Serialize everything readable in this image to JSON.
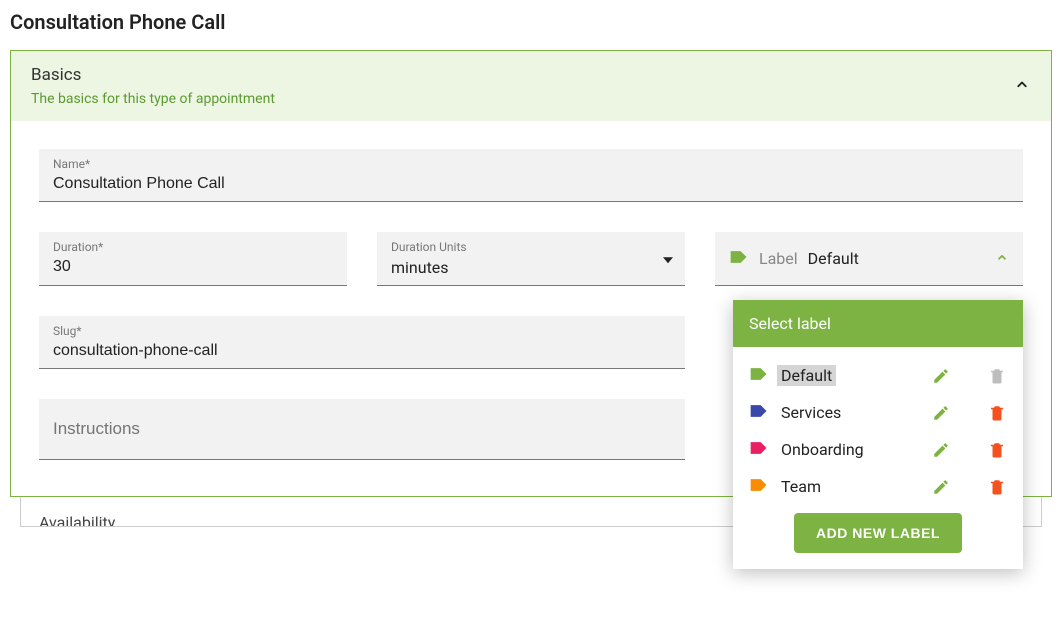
{
  "pageTitle": "Consultation Phone Call",
  "panel": {
    "title": "Basics",
    "subtitle": "The basics for this type of appointment"
  },
  "fields": {
    "name": {
      "label": "Name*",
      "value": "Consultation Phone Call"
    },
    "duration": {
      "label": "Duration*",
      "value": "30"
    },
    "durationUnits": {
      "label": "Duration Units",
      "value": "minutes"
    },
    "slug": {
      "label": "Slug*",
      "value": "consultation-phone-call"
    },
    "instructions": {
      "placeholder": "Instructions"
    },
    "label": {
      "label": "Label",
      "value": "Default"
    }
  },
  "dropdown": {
    "header": "Select label",
    "options": [
      {
        "name": "Default",
        "color": "#7cb342",
        "selected": true,
        "deletable": false
      },
      {
        "name": "Services",
        "color": "#3949ab",
        "selected": false,
        "deletable": true
      },
      {
        "name": "Onboarding",
        "color": "#e91e63",
        "selected": false,
        "deletable": true
      },
      {
        "name": "Team",
        "color": "#fb8c00",
        "selected": false,
        "deletable": true
      }
    ],
    "addButton": "ADD NEW LABEL"
  },
  "availability": {
    "title": "Availability"
  }
}
